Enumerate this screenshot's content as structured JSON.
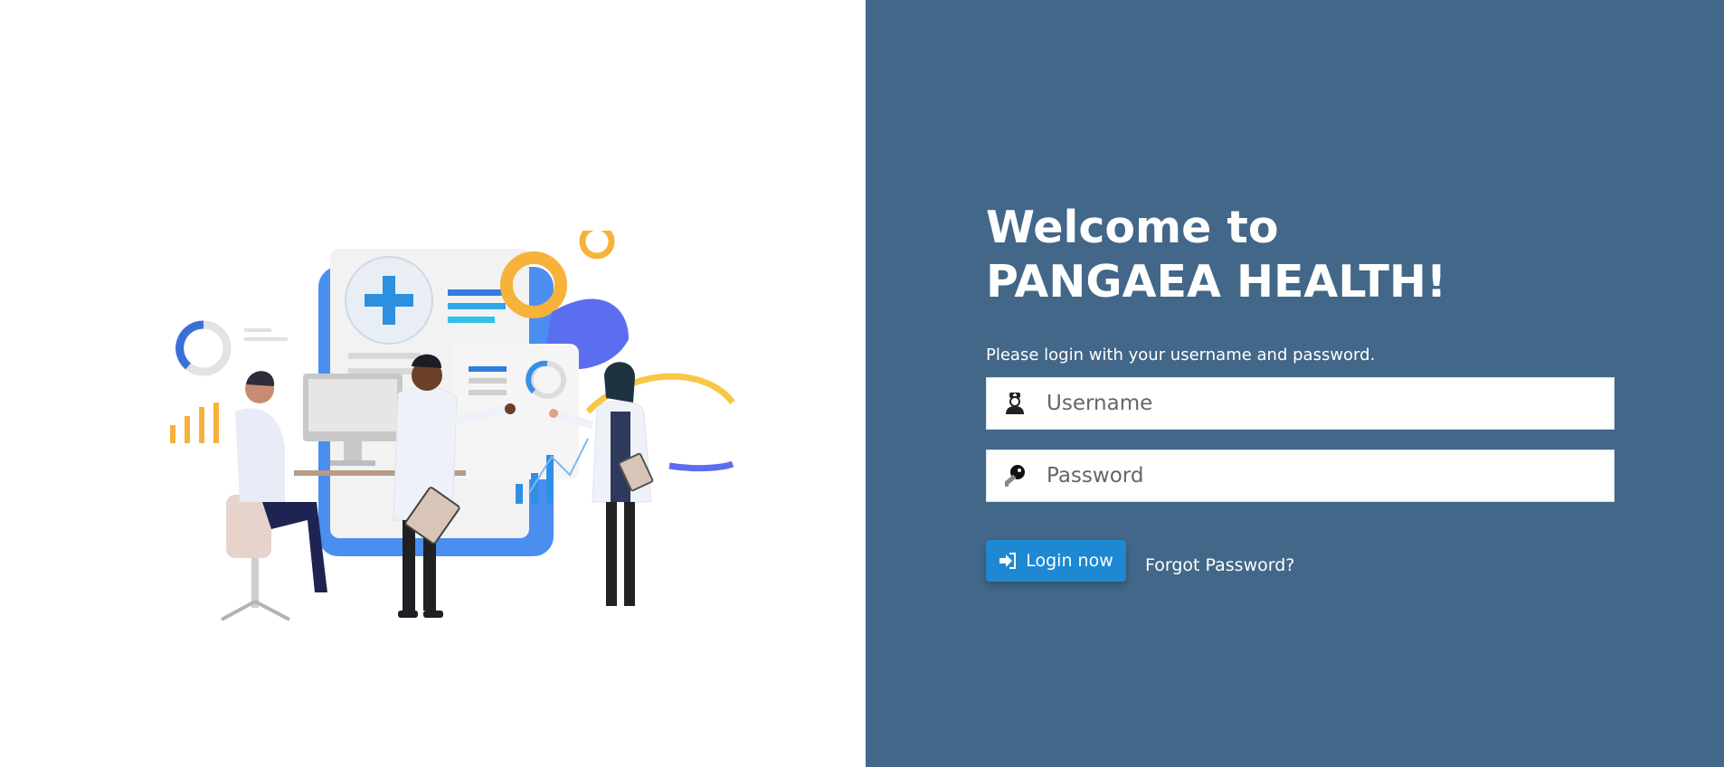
{
  "hero": {
    "title_line1": "Welcome to",
    "title_line2": "PANGAEA HEALTH!",
    "subtitle": "Please login with your username and password."
  },
  "form": {
    "username_placeholder": "Username",
    "password_placeholder": "Password",
    "username_value": "",
    "password_value": "",
    "login_label": "Login now",
    "forgot_label": "Forgot Password?"
  },
  "colors": {
    "panel_background": "#426789",
    "button": "#1e88d3",
    "white": "#ffffff"
  },
  "icons": {
    "username": "nurse-icon",
    "password": "key-icon",
    "login": "sign-in-icon"
  }
}
